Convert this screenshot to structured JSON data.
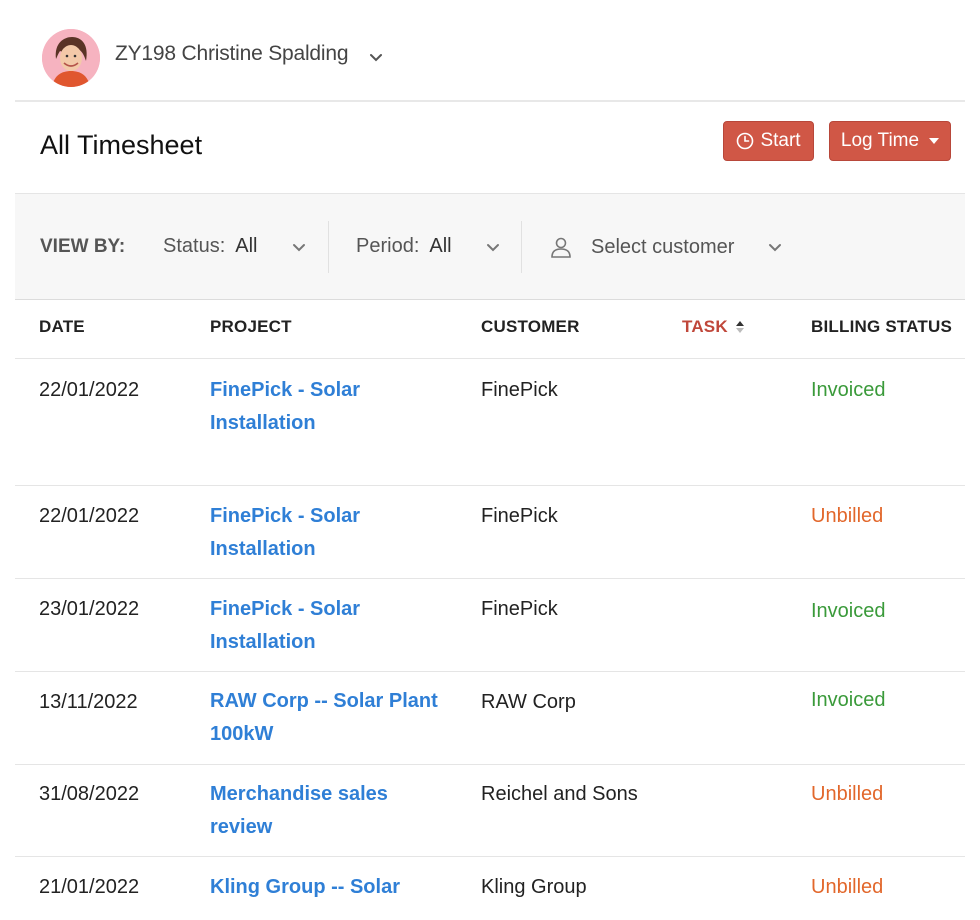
{
  "header": {
    "org_name": "ZY198 Christine Spalding"
  },
  "page": {
    "title": "All Timesheet",
    "start_label": "Start",
    "log_time_label": "Log Time"
  },
  "filters": {
    "view_by_label": "VIEW BY:",
    "status_label": "Status:",
    "status_value": "All",
    "period_label": "Period:",
    "period_value": "All",
    "customer_placeholder": "Select customer"
  },
  "table": {
    "columns": [
      "DATE",
      "PROJECT",
      "CUSTOMER",
      "TASK",
      "BILLING STATUS"
    ],
    "sorted_column": "TASK",
    "rows": [
      {
        "date": "22/01/2022",
        "project_line1": "FinePick - Solar",
        "project_line2": "Installation",
        "customer": "FinePick",
        "billing": "Invoiced"
      },
      {
        "date": "22/01/2022",
        "project_line1": "FinePick - Solar",
        "project_line2": "Installation",
        "customer": "FinePick",
        "billing": "Unbilled"
      },
      {
        "date": "23/01/2022",
        "project_line1": "FinePick - Solar",
        "project_line2": "Installation",
        "customer": "FinePick",
        "billing": "Invoiced"
      },
      {
        "date": "13/11/2022",
        "project_line1": "RAW Corp -- Solar Plant",
        "project_line2": "100kW",
        "customer": "RAW Corp",
        "billing": "Invoiced"
      },
      {
        "date": "31/08/2022",
        "project_line1": "Merchandise sales",
        "project_line2": "review",
        "customer": "Reichel and Sons",
        "billing": "Unbilled"
      },
      {
        "date": "21/01/2022",
        "project_line1": "Kling Group -- Solar",
        "project_line2": "",
        "customer": "Kling Group",
        "billing": "Unbilled"
      }
    ]
  },
  "colors": {
    "accent": "#d05746",
    "link": "#2f7fd6",
    "invoiced": "#3a9a3a",
    "unbilled": "#e2672b"
  }
}
